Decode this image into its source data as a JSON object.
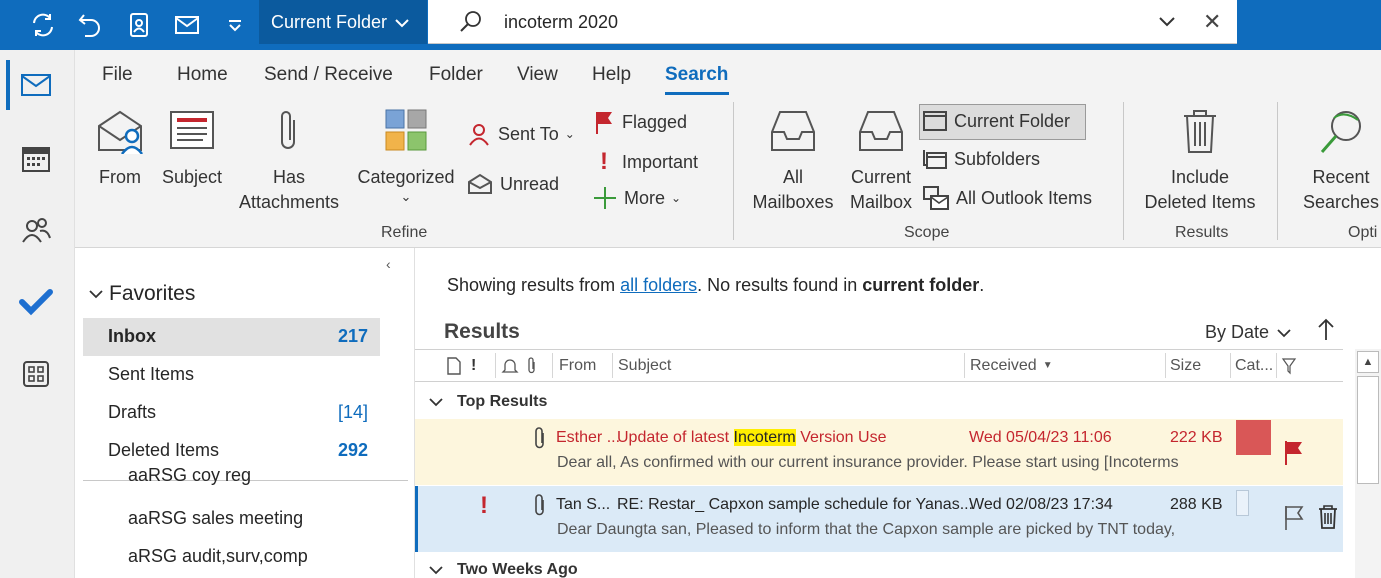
{
  "quick_access": {
    "current_folder_label": "Current Folder",
    "search_text": "incoterm 2020"
  },
  "ribbon": {
    "tabs": [
      "File",
      "Home",
      "Send / Receive",
      "Folder",
      "View",
      "Help",
      "Search"
    ],
    "active_tab": "Search",
    "refine": {
      "from": "From",
      "subject": "Subject",
      "has_attachments_1": "Has",
      "has_attachments_2": "Attachments",
      "categorized": "Categorized",
      "sent_to": "Sent To",
      "unread": "Unread",
      "flagged": "Flagged",
      "important": "Important",
      "more": "More",
      "label": "Refine"
    },
    "scope": {
      "all_mailboxes_1": "All",
      "all_mailboxes_2": "Mailboxes",
      "current_mailbox_1": "Current",
      "current_mailbox_2": "Mailbox",
      "current_folder": "Current Folder",
      "subfolders": "Subfolders",
      "all_outlook_items": "All Outlook Items",
      "label": "Scope"
    },
    "results": {
      "include_deleted_1": "Include",
      "include_deleted_2": "Deleted Items",
      "label": "Results"
    },
    "options": {
      "recent_searches_1": "Recent",
      "recent_searches_2": "Searches",
      "label": "Opti"
    }
  },
  "folders": {
    "favorites_label": "Favorites",
    "items": [
      {
        "name": "Inbox",
        "count": "217"
      },
      {
        "name": "Sent Items",
        "count": ""
      },
      {
        "name": "Drafts",
        "count": "[14]"
      },
      {
        "name": "Deleted Items",
        "count": "292"
      }
    ],
    "sub_items": [
      "aaRSG coy reg",
      "aaRSG sales meeting",
      "aRSG audit,surv,comp"
    ]
  },
  "results": {
    "info_prefix": "Showing results from ",
    "info_link": "all folders",
    "info_middle": ". No results found in ",
    "info_bold": "current folder",
    "info_suffix": ".",
    "title": "Results",
    "sort_label": "By Date",
    "columns": {
      "from": "From",
      "subject": "Subject",
      "received": "Received",
      "size": "Size",
      "categories": "Cat..."
    },
    "groups": [
      "Top Results",
      "Two Weeks Ago"
    ],
    "rows": [
      {
        "from": "Esther ...",
        "subject_prefix": "Update of  latest ",
        "subject_highlight": "Incoterm",
        "subject_suffix": " Version Use",
        "received": "Wed 05/04/23 11:06",
        "size": "222 KB",
        "preview": "Dear all,  As confirmed with our current insurance provider.  Please start using  [Incoterms",
        "category_color": "#d95757",
        "flagged": true,
        "important": false
      },
      {
        "from": "Tan S...",
        "subject": "RE: Restar_ Capxon sample schedule for Yanas...",
        "received": "Wed 02/08/23 17:34",
        "size": "288 KB",
        "preview": "Dear Daungta san,  Pleased to inform that the Capxon sample are picked by TNT today,",
        "flagged": false,
        "important": true
      }
    ]
  },
  "colors": {
    "accent": "#0f6cbd",
    "unread_red": "#c4262e",
    "highlight": "#ffee00"
  }
}
